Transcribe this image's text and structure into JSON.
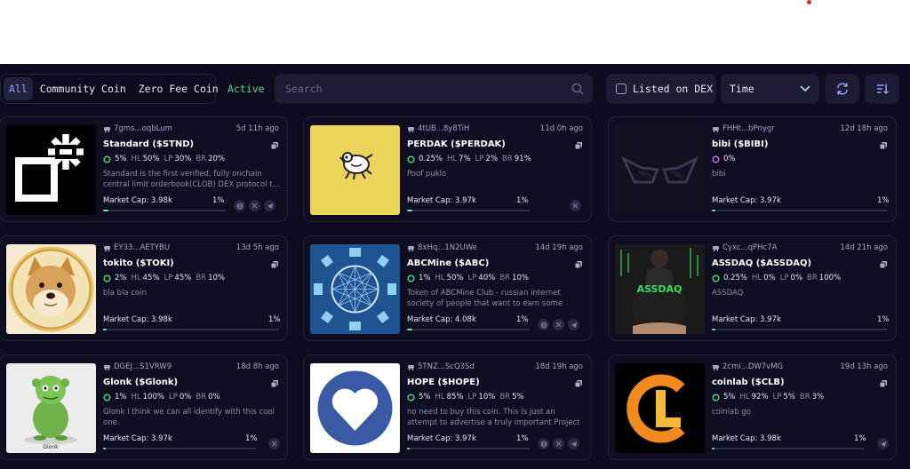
{
  "filters": {
    "all": "All",
    "community": "Community Coin",
    "zero_fee": "Zero Fee Coin",
    "active": "Active"
  },
  "search": {
    "placeholder": "Search"
  },
  "listed_on_dex": "Listed on DEX",
  "sort": {
    "selected": "Time"
  },
  "colors": {
    "accent": "#8ea2ff",
    "active_green": "#4ade80",
    "progress": "#6ee7a0",
    "card_bg": "#0f0d22"
  },
  "cards": [
    {
      "addr": "7gms...oqbLum",
      "ago": "5d 11h ago",
      "name": "Standard ($STND)",
      "v1": "5%",
      "hl": "50%",
      "lp": "30%",
      "br": "20%",
      "desc": "Standard is the first verified, fully onchain central limit orderbook(CLOB) DEX protocol t...",
      "mcap": "Market Cap: 3.98k",
      "pct": "1%",
      "progress": 0.04,
      "socials": [
        "globe-icon",
        "x-icon",
        "telegram-icon"
      ]
    },
    {
      "addr": "4tUB...8y8TiH",
      "ago": "11d 0h ago",
      "name": "PERDAK ($PERDAK)",
      "v1": "0.25%",
      "hl": "7%",
      "lp": "2%",
      "br": "91%",
      "desc": "Poof puklo",
      "mcap": "Market Cap: 3.97k",
      "pct": "1%",
      "progress": 0.04,
      "socials": [
        "x-icon"
      ]
    },
    {
      "addr": "FHHt...bPnygr",
      "ago": "12d 18h ago",
      "name": "bibi ($BIBI)",
      "v1": "0%",
      "desc": "bibi",
      "mcap": "Market Cap: 3.97k",
      "pct": "1%",
      "progress": 0.02,
      "socials": []
    },
    {
      "addr": "EY33...AETYBU",
      "ago": "13d 5h ago",
      "name": "tokito ($TOKI)",
      "v1": "2%",
      "hl": "45%",
      "lp": "45%",
      "br": "10%",
      "desc": "bla bla coin",
      "mcap": "Market Cap: 3.98k",
      "pct": "1%",
      "progress": 0.02,
      "socials": []
    },
    {
      "addr": "8xHq...1N2UWe",
      "ago": "14d 19h ago",
      "name": "ABCMine ($ABC)",
      "v1": "1%",
      "hl": "50%",
      "lp": "40%",
      "br": "10%",
      "desc": "Token of ABCMine Club - russian internet society of people that want to earn some extr...",
      "mcap": "Market Cap: 4.08k",
      "pct": "1%",
      "progress": 0.04,
      "socials": [
        "globe-icon",
        "x-icon",
        "telegram-icon"
      ]
    },
    {
      "addr": "Cyxc...qPHc7A",
      "ago": "14d 21h ago",
      "name": "ASSDAQ ($ASSDAQ)",
      "v1": "0.25%",
      "hl": "0%",
      "lp": "0%",
      "br": "100%",
      "desc": "ASSDAQ",
      "mcap": "Market Cap: 3.97k",
      "pct": "1%",
      "progress": 0.02,
      "socials": []
    },
    {
      "addr": "DGEJ...S1VRW9",
      "ago": "18d 8h ago",
      "name": "Glonk ($Glonk)",
      "v1": "1%",
      "hl": "100%",
      "lp": "0%",
      "br": "0%",
      "desc": "Glonk I think we can all identify with this cool one.",
      "mcap": "Market Cap: 3.97k",
      "pct": "1%",
      "progress": 0.02,
      "socials": [
        "x-icon"
      ],
      "thumb_caption": "Glonk"
    },
    {
      "addr": "5TNZ...ScQ3Sd",
      "ago": "18d 19h ago",
      "name": "HOPE ($HOPE)",
      "v1": "5%",
      "hl": "85%",
      "lp": "10%",
      "br": "5%",
      "desc": "no need to buy this coin. This is just an attempt to advertise a truly important Project that is...",
      "mcap": "Market Cap: 3.97k",
      "pct": "1%",
      "progress": 0.02,
      "socials": [
        "globe-icon",
        "x-icon",
        "telegram-icon"
      ]
    },
    {
      "addr": "2cmi...DW7vMG",
      "ago": "19d 13h ago",
      "name": "coinlab ($CLB)",
      "v1": "5%",
      "hl": "92%",
      "lp": "5%",
      "br": "3%",
      "desc": "coinlab go",
      "mcap": "Market Cap: 3.98k",
      "pct": "1%",
      "progress": 0.02,
      "socials": [
        "telegram-icon"
      ]
    }
  ]
}
